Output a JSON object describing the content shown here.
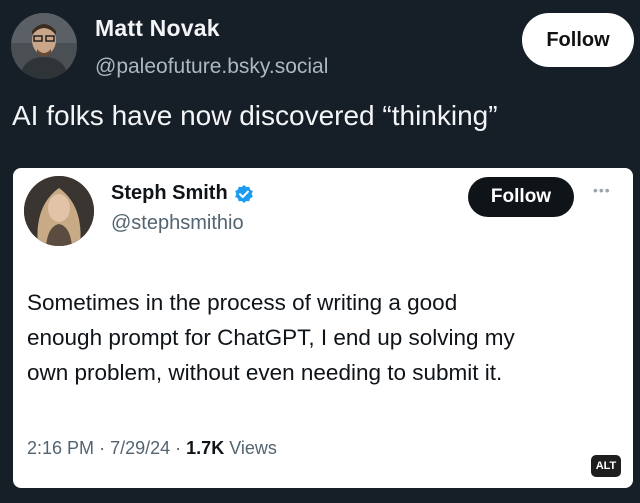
{
  "colors": {
    "background": "#161e27",
    "card_background": "#ffffff",
    "verified_badge": "#1d9bf0",
    "follow_outer_bg": "#ffffff",
    "follow_inner_bg": "#0f1419"
  },
  "outer_post": {
    "author_name": "Matt Novak",
    "author_handle": "@paleofuture.bsky.social",
    "follow_label": "Follow",
    "text": "AI folks have now discovered “thinking”"
  },
  "quoted_tweet": {
    "author_name": "Steph Smith",
    "author_handle": "@stephsmithio",
    "verified_icon": "verified-badge-icon",
    "follow_label": "Follow",
    "more_icon": "more-options-icon",
    "text_lines": [
      "Sometimes in the process of writing a good",
      "enough prompt for ChatGPT, I end up solving my",
      "own problem, without even needing to submit it."
    ],
    "time": "2:16 PM",
    "separator": "·",
    "date": "7/29/24",
    "views_count": "1.7K",
    "views_label": "Views",
    "alt_badge": "ALT"
  }
}
